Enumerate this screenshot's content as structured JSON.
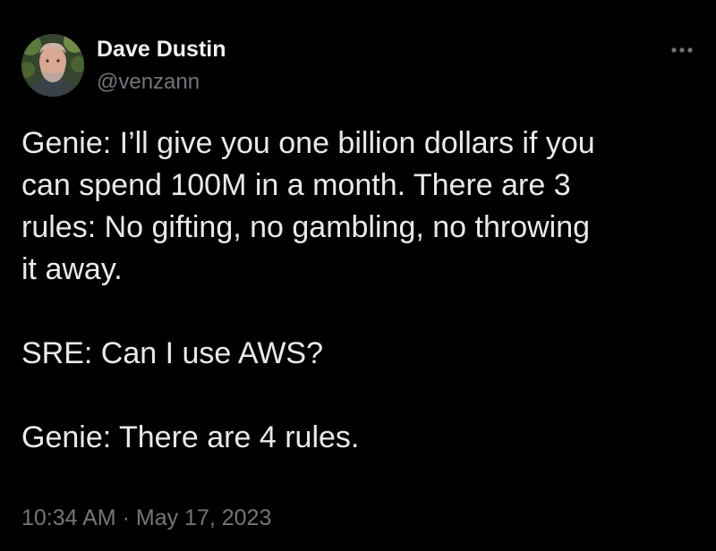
{
  "author": {
    "display_name": "Dave Dustin",
    "handle": "@venzann",
    "avatar_icon": "profile-photo"
  },
  "more_icon": "more-horizontal-icon",
  "tweet": {
    "paragraphs": [
      {
        "lines": [
          "Genie: I’ll give you one billion dollars if you",
          "can spend 100M in a month. There are 3",
          "rules: No gifting, no gambling, no throwing",
          "it away."
        ]
      },
      {
        "lines": [
          "SRE: Can I use AWS?"
        ]
      },
      {
        "lines": [
          "Genie: There are 4 rules."
        ]
      }
    ],
    "time": "10:34 AM",
    "separator": "·",
    "date": "May 17, 2023"
  },
  "colors": {
    "background": "#000000",
    "primary_text": "#e7e9ea",
    "secondary_text": "#71767b"
  }
}
